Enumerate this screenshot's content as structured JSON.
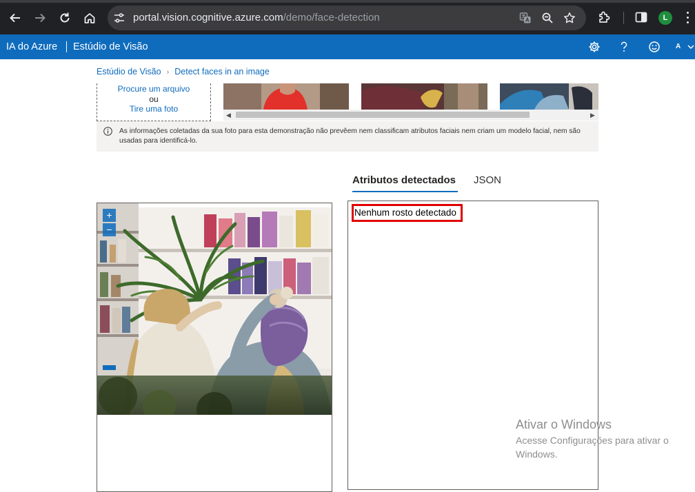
{
  "browser": {
    "url_host": "portal.vision.cognitive.azure.com",
    "url_path": "/demo/face-detection",
    "profile_initial": "L",
    "icons": [
      "back-icon",
      "forward-icon",
      "reload-icon",
      "home-icon",
      "site-settings-icon",
      "translate-icon",
      "zoom-icon",
      "bookmark-star-icon",
      "extensions-icon",
      "side-panel-icon",
      "kebab-menu-icon"
    ]
  },
  "header": {
    "brand": "IA do Azure",
    "product": "Estúdio de Visão",
    "account_initial": "A",
    "icons": [
      "settings-icon",
      "help-icon",
      "smiley-icon",
      "chevron-down-icon"
    ],
    "color": "#0f6cbd"
  },
  "breadcrumb": {
    "items": [
      "Estúdio de Visão",
      "Detect faces in an image"
    ]
  },
  "upload": {
    "browse_label": "Procure um arquivo",
    "or_label": "ou",
    "camera_label": "Tire uma foto"
  },
  "notice": {
    "text": "As informações coletadas da sua foto para esta demonstração não prevêem nem classificam atributos faciais nem criam um modelo facial, nem são usadas para identificá-lo."
  },
  "tabs": [
    {
      "label": "Atributos detectados",
      "active": true
    },
    {
      "label": "JSON",
      "active": false
    }
  ],
  "image_controls": {
    "zoom_in": "+",
    "zoom_out": "−"
  },
  "results": {
    "message": "Nenhum rosto detectado"
  },
  "watermark": {
    "title": "Ativar o Windows",
    "subtitle": "Acesse Configurações para ativar o Windows."
  }
}
